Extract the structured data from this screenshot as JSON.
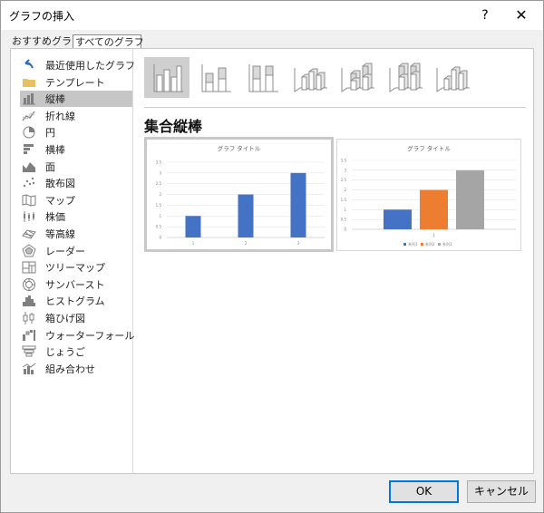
{
  "dialog": {
    "title": "グラフの挿入",
    "help": "?",
    "close": "✕"
  },
  "tabs": [
    {
      "label": "おすすめグラフ"
    },
    {
      "label": "すべてのグラフ"
    }
  ],
  "sidebar": {
    "items": [
      {
        "label": "最近使用したグラフ",
        "icon": "recent-icon"
      },
      {
        "label": "テンプレート",
        "icon": "folder-icon"
      },
      {
        "label": "縦棒",
        "icon": "column-chart-icon"
      },
      {
        "label": "折れ線",
        "icon": "line-chart-icon"
      },
      {
        "label": "円",
        "icon": "pie-chart-icon"
      },
      {
        "label": "横棒",
        "icon": "bar-chart-icon"
      },
      {
        "label": "面",
        "icon": "area-chart-icon"
      },
      {
        "label": "散布図",
        "icon": "scatter-chart-icon"
      },
      {
        "label": "マップ",
        "icon": "map-chart-icon"
      },
      {
        "label": "株価",
        "icon": "stock-chart-icon"
      },
      {
        "label": "等高線",
        "icon": "surface-chart-icon"
      },
      {
        "label": "レーダー",
        "icon": "radar-chart-icon"
      },
      {
        "label": "ツリーマップ",
        "icon": "treemap-chart-icon"
      },
      {
        "label": "サンバースト",
        "icon": "sunburst-chart-icon"
      },
      {
        "label": "ヒストグラム",
        "icon": "histogram-chart-icon"
      },
      {
        "label": "箱ひげ図",
        "icon": "box-whisker-chart-icon"
      },
      {
        "label": "ウォーターフォール",
        "icon": "waterfall-chart-icon"
      },
      {
        "label": "じょうご",
        "icon": "funnel-chart-icon"
      },
      {
        "label": "組み合わせ",
        "icon": "combo-chart-icon"
      }
    ],
    "selected_index": 2
  },
  "gallery": {
    "items": [
      {
        "icon": "clustered-column-icon"
      },
      {
        "icon": "stacked-column-icon"
      },
      {
        "icon": "100-stacked-column-icon"
      },
      {
        "icon": "3d-clustered-column-icon"
      },
      {
        "icon": "3d-stacked-column-icon"
      },
      {
        "icon": "3d-100-stacked-column-icon"
      },
      {
        "icon": "3d-column-icon"
      }
    ],
    "selected_index": 0
  },
  "subtype_title": "集合縦棒",
  "colors": {
    "series1": "#4472C4",
    "series2": "#ED7D31",
    "series3": "#A5A5A5",
    "selection": "#c6c6c6",
    "ok_border": "#0078d7"
  },
  "chart_data": [
    {
      "type": "bar",
      "title": "グラフ タイトル",
      "categories": [
        "1",
        "2",
        "3"
      ],
      "series": [
        {
          "values": [
            1,
            2,
            3
          ]
        }
      ],
      "ylim": [
        0,
        3.5
      ],
      "yticks": [
        "0",
        "0.5",
        "1",
        "1.5",
        "2",
        "2.5",
        "3",
        "3.5"
      ],
      "grid": true
    },
    {
      "type": "bar",
      "title": "グラフ タイトル",
      "categories": [
        "1"
      ],
      "series": [
        {
          "name": "系列1",
          "values": [
            1
          ]
        },
        {
          "name": "系列2",
          "values": [
            2
          ]
        },
        {
          "name": "系列3",
          "values": [
            3
          ]
        }
      ],
      "ylim": [
        0,
        3.5
      ],
      "yticks": [
        "0",
        "0.5",
        "1",
        "1.5",
        "2",
        "2.5",
        "3",
        "3.5"
      ],
      "grid": true,
      "legend": "bottom"
    }
  ],
  "footer": {
    "ok": "OK",
    "cancel": "キャンセル"
  }
}
